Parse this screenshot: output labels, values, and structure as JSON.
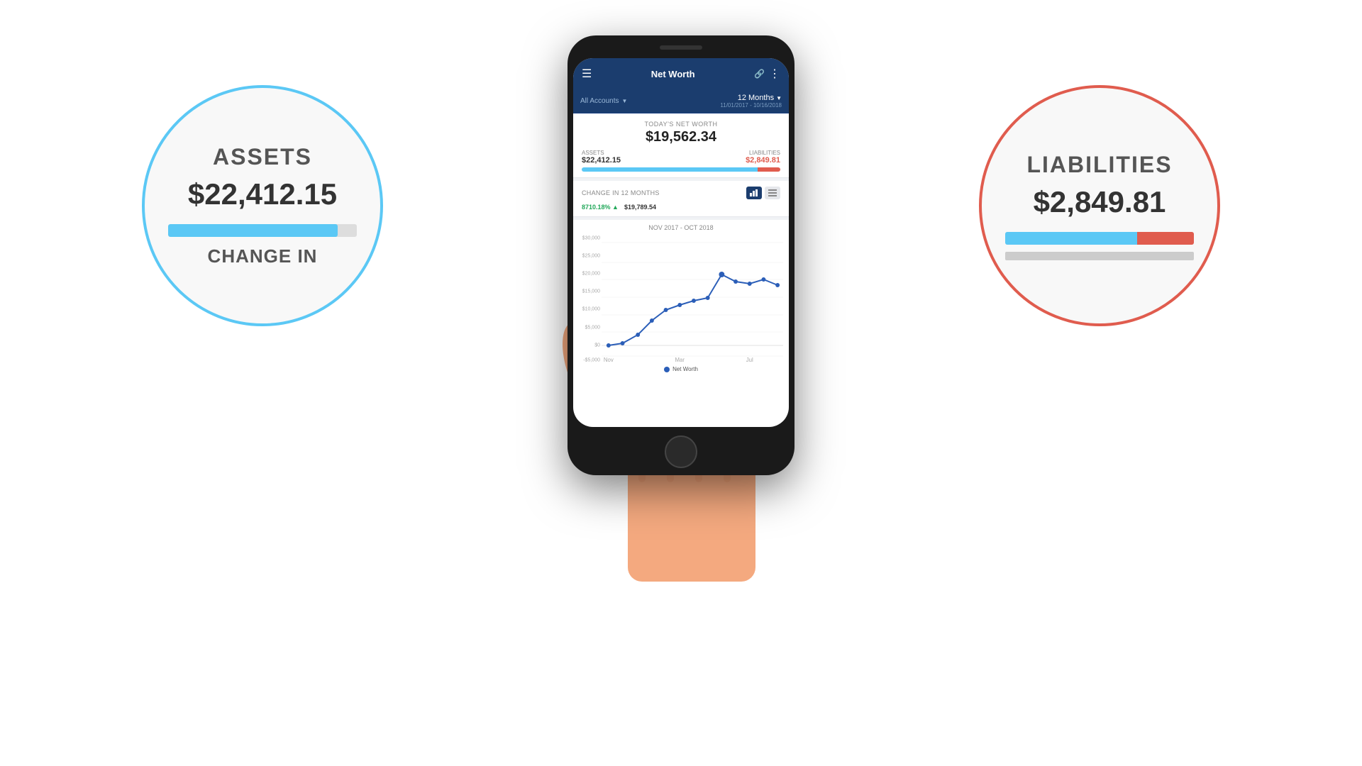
{
  "assets_circle": {
    "label": "ASSETS",
    "value": "$22,412.15",
    "bar_width": "90%",
    "change_label": "CHANGE IN"
  },
  "liabilities_circle": {
    "label": "LIABILITIES",
    "value": "$2,849.81"
  },
  "phone": {
    "header": {
      "menu_icon": "☰",
      "title": "Net Worth",
      "link_icon": "🔗",
      "more_icon": "⋮"
    },
    "filter": {
      "accounts_label": "All Accounts",
      "period_label": "12 Months",
      "period_dates": "11/01/2017 - 10/16/2018"
    },
    "net_worth": {
      "section_label": "TODAY'S NET WORTH",
      "value": "$19,562.34",
      "assets_label": "ASSETS",
      "assets_value": "$22,412.15",
      "liabilities_label": "LIABILITIES",
      "liabilities_value": "$2,849.81"
    },
    "change": {
      "label": "CHANGE IN 12 MONTHS",
      "percentage": "8710.18% ▲",
      "amount": "$19,789.54"
    },
    "chart": {
      "period": "NOV 2017 - OCT 2018",
      "y_labels": [
        "$30,000",
        "$25,000",
        "$20,000",
        "$15,000",
        "$10,000",
        "$5,000",
        "$0",
        "-$5,000"
      ],
      "x_labels": [
        "Nov",
        "Mar",
        "Jul"
      ],
      "legend": "Net Worth"
    }
  }
}
